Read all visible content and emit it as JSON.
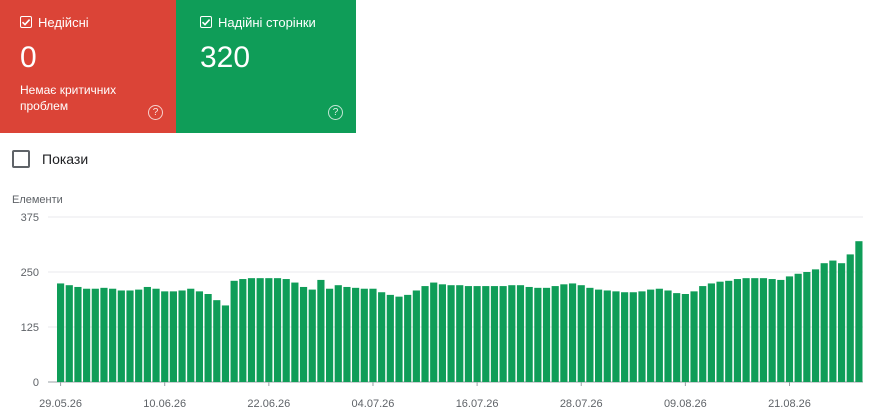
{
  "cards": {
    "invalid": {
      "label": "Недійсні",
      "value": "0",
      "description": "Немає критичних проблем",
      "color": "#db4437"
    },
    "valid": {
      "label": "Надійні сторінки",
      "value": "320",
      "color": "#0f9d58"
    }
  },
  "show_toggle": {
    "label": "Покази"
  },
  "chart_data": {
    "type": "bar",
    "ylabel": "Елементи",
    "ylim": [
      0,
      375
    ],
    "yticks": [
      "0",
      "125",
      "250",
      "375"
    ],
    "xtick_labels": [
      "29.05.26",
      "10.06.26",
      "22.06.26",
      "04.07.26",
      "16.07.26",
      "28.07.26",
      "09.08.26",
      "21.08.26"
    ],
    "series": [
      {
        "color": "#0f9d58",
        "values": [
          224,
          220,
          216,
          212,
          212,
          214,
          212,
          208,
          208,
          210,
          216,
          212,
          206,
          206,
          208,
          212,
          206,
          200,
          186,
          174,
          230,
          234,
          236,
          236,
          236,
          236,
          234,
          226,
          216,
          210,
          232,
          212,
          220,
          216,
          214,
          212,
          212,
          204,
          198,
          194,
          198,
          208,
          218,
          226,
          222,
          220,
          220,
          218,
          218,
          218,
          218,
          218,
          220,
          220,
          216,
          214,
          214,
          218,
          222,
          224,
          220,
          214,
          210,
          208,
          206,
          204,
          204,
          206,
          210,
          212,
          208,
          202,
          200,
          206,
          218,
          224,
          228,
          230,
          234,
          236,
          236,
          236,
          234,
          232,
          240,
          246,
          250,
          256,
          270,
          276,
          270,
          290,
          320
        ]
      }
    ]
  }
}
